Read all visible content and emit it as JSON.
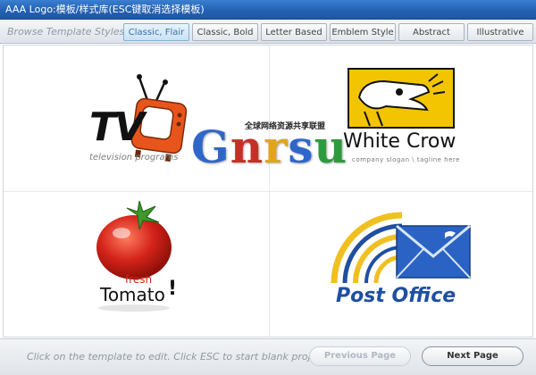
{
  "window": {
    "title": "AAA Logo:模板/样式库(ESC键取消选择模板)"
  },
  "style_bar": {
    "label": "Browse Template Styles:",
    "tabs": [
      {
        "label": "Classic, Flair",
        "active": true
      },
      {
        "label": "Classic, Bold",
        "active": false
      },
      {
        "label": "Letter Based",
        "active": false
      },
      {
        "label": "Emblem Style",
        "active": false
      },
      {
        "label": "Abstract",
        "active": false
      },
      {
        "label": "Illustrative",
        "active": false
      }
    ]
  },
  "templates": [
    {
      "name": "TV",
      "tagline": "television programs"
    },
    {
      "name": "White Crow",
      "tagline": "company slogan \\ tagline here"
    },
    {
      "name": "Tomato",
      "prefix": "fresh",
      "suffix": "!"
    },
    {
      "name": "Post Office"
    }
  ],
  "watermark": {
    "text": "Gnrsu",
    "subtitle": "全球网络资源共享联盟"
  },
  "footer": {
    "hint": "Click on the template to edit. Click ESC to start blank project",
    "prev_label": "Previous Page",
    "next_label": "Next Page",
    "prev_enabled": false
  },
  "colors": {
    "titlebar": "#2461b3",
    "active_tab": "#c8e2f5",
    "tv_orange": "#e8551c",
    "crow_yellow": "#f3c400",
    "tomato_red": "#d4231a",
    "post_blue": "#1f4fa0",
    "post_yellow": "#f0c020"
  }
}
